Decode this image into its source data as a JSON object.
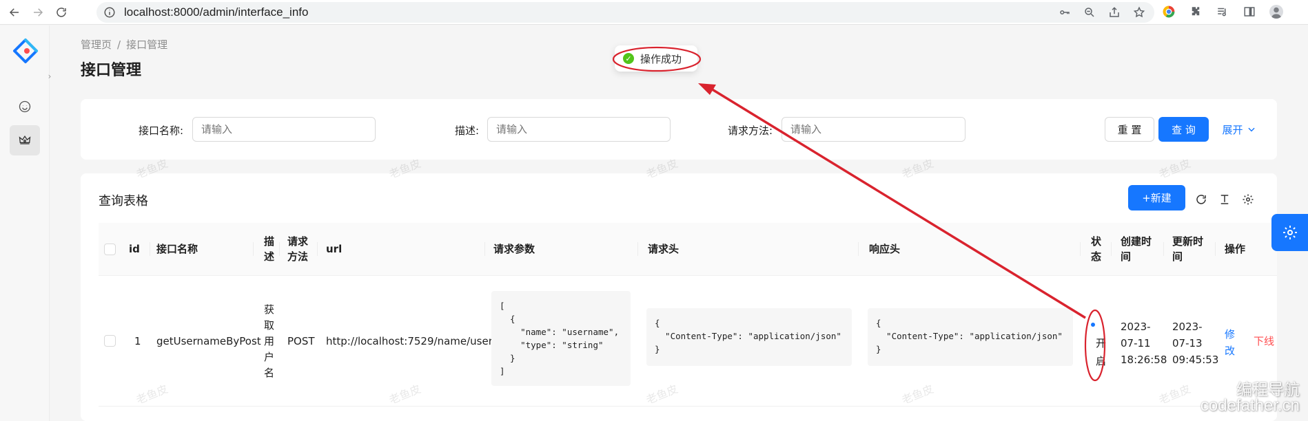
{
  "browser": {
    "url": "localhost:8000/admin/interface_info"
  },
  "header": {
    "breadcrumb": [
      "管理页",
      "接口管理"
    ],
    "breadcrumb_sep": "/",
    "title": "接口管理"
  },
  "toast": {
    "message": "操作成功"
  },
  "search": {
    "fields": [
      {
        "label": "接口名称:",
        "placeholder": "请输入"
      },
      {
        "label": "描述:",
        "placeholder": "请输入"
      },
      {
        "label": "请求方法:",
        "placeholder": "请输入"
      }
    ],
    "reset_label": "重 置",
    "query_label": "查 询",
    "expand_label": "展开"
  },
  "table": {
    "title": "查询表格",
    "new_label": "+新建",
    "columns": [
      "id",
      "接口名称",
      "描述",
      "请求方法",
      "url",
      "请求参数",
      "请求头",
      "响应头",
      "状态",
      "创建时间",
      "更新时间",
      "操作"
    ],
    "rows": [
      {
        "id": "1",
        "name": "getUsernameByPost",
        "description": "获取用户名",
        "method": "POST",
        "url": "http://localhost:7529/name/user",
        "request_params": "[\n  {\n    \"name\": \"username\",\n    \"type\": \"string\"\n  }\n]",
        "request_header": "{\n  \"Content-Type\": \"application/json\"\n}",
        "response_header": "{\n  \"Content-Type\": \"application/json\"\n}",
        "status": "开启",
        "created_at": [
          "2023-",
          "07-11",
          "18:26:58"
        ],
        "updated_at": [
          "2023-",
          "07-13",
          "09:45:53"
        ],
        "action_edit": "修改",
        "action_offline": "下线"
      }
    ]
  },
  "watermark": {
    "text": "老鱼皮",
    "brand_line1": "编程导航",
    "brand_line2": "codefather.cn"
  },
  "colors": {
    "primary": "#1677ff",
    "success": "#52c41a",
    "danger": "#ff4d4f",
    "annotation": "#d9232e"
  }
}
